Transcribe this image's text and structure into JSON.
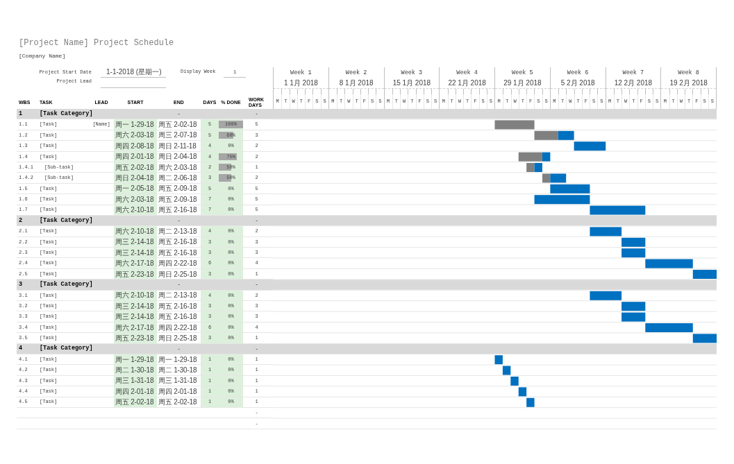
{
  "title": "[Project Name] Project Schedule",
  "company": "[Company Name]",
  "settings": {
    "start_date": {
      "label": "Project Start Date",
      "value": "1-1-2018 (星期一)"
    },
    "display_week": {
      "label": "Display Week",
      "value": "1"
    },
    "project_lead": {
      "label": "Project Lead"
    }
  },
  "columns": [
    "WBS",
    "TASK",
    "LEAD",
    "START",
    "END",
    "DAYS",
    "% DONE",
    "WORK DAYS"
  ],
  "timeline": {
    "weeks": [
      {
        "label": "Week 1",
        "date": "1 1月 2018",
        "days": [
          "M",
          "T",
          "W",
          "T",
          "F",
          "S",
          "S"
        ]
      },
      {
        "label": "Week 2",
        "date": "8 1月 2018",
        "days": [
          "M",
          "T",
          "W",
          "T",
          "F",
          "S",
          "S"
        ]
      },
      {
        "label": "Week 3",
        "date": "15 1月 2018",
        "days": [
          "M",
          "T",
          "W",
          "T",
          "F",
          "S",
          "S"
        ]
      },
      {
        "label": "Week 4",
        "date": "22 1月 2018",
        "days": [
          "M",
          "T",
          "W",
          "T",
          "F",
          "S",
          "S"
        ]
      },
      {
        "label": "Week 5",
        "date": "29 1月 2018",
        "days": [
          "M",
          "T",
          "W",
          "T",
          "F",
          "S",
          "S"
        ]
      },
      {
        "label": "Week 6",
        "date": "5 2月 2018",
        "days": [
          "M",
          "T",
          "W",
          "T",
          "F",
          "S",
          "S"
        ]
      },
      {
        "label": "Week 7",
        "date": "12 2月 2018",
        "days": [
          "M",
          "T",
          "W",
          "T",
          "F",
          "S",
          "S"
        ]
      },
      {
        "label": "Week 8",
        "date": "19 2月 2018",
        "days": [
          "M",
          "T",
          "W",
          "T",
          "F",
          "S",
          "S"
        ]
      }
    ]
  },
  "rows": [
    {
      "kind": "category",
      "wbs": "1",
      "task": "[Task Category]",
      "end": "-",
      "work_days": "-"
    },
    {
      "kind": "task",
      "wbs": "1.1",
      "task": "[Task]",
      "lead": "[Name]",
      "start": "周一 1-29-18",
      "end": "周五 2-02-18",
      "days": "5",
      "done": "100%",
      "level": 1,
      "work_days": "5"
    },
    {
      "kind": "task",
      "wbs": "1.2",
      "task": "[Task]",
      "start": "周六 2-03-18",
      "end": "周三 2-07-18",
      "days": "5",
      "done": "60%",
      "level": 0.6,
      "work_days": "3"
    },
    {
      "kind": "task",
      "wbs": "1.3",
      "task": "[Task]",
      "start": "周四 2-08-18",
      "end": "周日 2-11-18",
      "days": "4",
      "done": "0%",
      "work_days": "2"
    },
    {
      "kind": "task",
      "wbs": "1.4",
      "task": "[Task]",
      "start": "周四 2-01-18",
      "end": "周日 2-04-18",
      "days": "4",
      "done": "75%",
      "level": 0.75,
      "work_days": "2",
      "children": [
        {
          "kind": "task",
          "wbs": "1.4.1",
          "task": "[Sub-task]",
          "start": "周五 2-02-18",
          "end": "周六 2-03-18",
          "days": "2",
          "done": "50%",
          "level": 0.5,
          "work_days": "1"
        },
        {
          "kind": "task",
          "wbs": "1.4.2",
          "task": "[Sub-task]",
          "start": "周日 2-04-18",
          "end": "周二 2-06-18",
          "days": "3",
          "done": "50%",
          "level": 0.5,
          "work_days": "2"
        }
      ]
    },
    {
      "kind": "task",
      "wbs": "1.5",
      "task": "[Task]",
      "start": "周一 2-05-18",
      "end": "周五 2-09-18",
      "days": "5",
      "done": "0%",
      "work_days": "5"
    },
    {
      "kind": "task",
      "wbs": "1.6",
      "task": "[Task]",
      "start": "周六 2-03-18",
      "end": "周五 2-09-18",
      "days": "7",
      "done": "0%",
      "work_days": "5"
    },
    {
      "kind": "task",
      "wbs": "1.7",
      "task": "[Task]",
      "start": "周六 2-10-18",
      "end": "周五 2-16-18",
      "days": "7",
      "done": "0%",
      "work_days": "5"
    },
    {
      "kind": "category",
      "wbs": "2",
      "task": "[Task Category]",
      "end": "-",
      "work_days": "-"
    },
    {
      "kind": "task",
      "wbs": "2.1",
      "task": "[Task]",
      "start": "周六 2-10-18",
      "end": "周二 2-13-18",
      "days": "4",
      "done": "0%",
      "work_days": "2"
    },
    {
      "kind": "task",
      "wbs": "2.2",
      "task": "[Task]",
      "start": "周三 2-14-18",
      "end": "周五 2-16-18",
      "days": "3",
      "done": "0%",
      "work_days": "3"
    },
    {
      "kind": "task",
      "wbs": "2.3",
      "task": "[Task]",
      "start": "周三 2-14-18",
      "end": "周五 2-16-18",
      "days": "3",
      "done": "0%",
      "work_days": "3"
    },
    {
      "kind": "task",
      "wbs": "2.4",
      "task": "[Task]",
      "start": "周六 2-17-18",
      "end": "周四 2-22-18",
      "days": "6",
      "done": "0%",
      "work_days": "4"
    },
    {
      "kind": "task",
      "wbs": "2.5",
      "task": "[Task]",
      "start": "周五 2-23-18",
      "end": "周日 2-25-18",
      "days": "3",
      "done": "0%",
      "work_days": "1"
    },
    {
      "kind": "category",
      "wbs": "3",
      "task": "[Task Category]",
      "end": "-",
      "work_days": "-"
    },
    {
      "kind": "task",
      "wbs": "3.1",
      "task": "[Task]",
      "start": "周六 2-10-18",
      "end": "周二 2-13-18",
      "days": "4",
      "done": "0%",
      "work_days": "2"
    },
    {
      "kind": "task",
      "wbs": "3.2",
      "task": "[Task]",
      "start": "周三 2-14-18",
      "end": "周五 2-16-18",
      "days": "3",
      "done": "0%",
      "work_days": "3"
    },
    {
      "kind": "task",
      "wbs": "3.3",
      "task": "[Task]",
      "start": "周三 2-14-18",
      "end": "周五 2-16-18",
      "days": "3",
      "done": "0%",
      "work_days": "3"
    },
    {
      "kind": "task",
      "wbs": "3.4",
      "task": "[Task]",
      "start": "周六 2-17-18",
      "end": "周四 2-22-18",
      "days": "6",
      "done": "0%",
      "work_days": "4"
    },
    {
      "kind": "task",
      "wbs": "3.5",
      "task": "[Task]",
      "start": "周五 2-23-18",
      "end": "周日 2-25-18",
      "days": "3",
      "done": "0%",
      "work_days": "1"
    },
    {
      "kind": "category",
      "wbs": "4",
      "task": "[Task Category]",
      "end": "-",
      "work_days": "-"
    },
    {
      "kind": "task",
      "wbs": "4.1",
      "task": "[Task]",
      "start": "周一 1-29-18",
      "end": "周一 1-29-18",
      "days": "1",
      "done": "0%",
      "work_days": "1"
    },
    {
      "kind": "task",
      "wbs": "4.2",
      "task": "[Task]",
      "start": "周二 1-30-18",
      "end": "周二 1-30-18",
      "days": "1",
      "done": "0%",
      "work_days": "1"
    },
    {
      "kind": "task",
      "wbs": "4.3",
      "task": "[Task]",
      "start": "周三 1-31-18",
      "end": "周三 1-31-18",
      "days": "1",
      "done": "0%",
      "work_days": "1"
    },
    {
      "kind": "task",
      "wbs": "4.4",
      "task": "[Task]",
      "start": "周四 2-01-18",
      "end": "周四 2-01-18",
      "days": "1",
      "done": "0%",
      "work_days": "1"
    },
    {
      "kind": "task",
      "wbs": "4.5",
      "task": "[Task]",
      "start": "周五 2-02-18",
      "end": "周五 2-02-18",
      "days": "1",
      "done": "0%",
      "work_days": "1"
    },
    {
      "kind": "blank",
      "work_days": "-"
    },
    {
      "kind": "blank",
      "work_days": "-"
    }
  ]
}
